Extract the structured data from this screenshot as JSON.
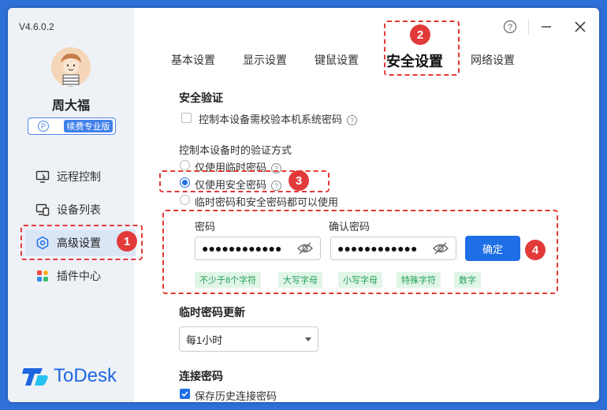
{
  "app": {
    "version": "V4.6.0.2",
    "brand": "ToDesk"
  },
  "user": {
    "name": "周大福",
    "badge_icon": "P",
    "badge_label": "续费专业版"
  },
  "sidebar": {
    "items": [
      {
        "label": "远程控制",
        "icon": "remote-control-icon"
      },
      {
        "label": "设备列表",
        "icon": "devices-icon"
      },
      {
        "label": "高级设置",
        "icon": "settings-hex-icon",
        "active": true
      },
      {
        "label": "插件中心",
        "icon": "plugins-icon"
      }
    ]
  },
  "window_controls": {
    "help": "?",
    "minimize": "—",
    "close": "✕"
  },
  "tabs": [
    {
      "label": "基本设置"
    },
    {
      "label": "显示设置"
    },
    {
      "label": "键鼠设置"
    },
    {
      "label": "安全设置",
      "active": true
    },
    {
      "label": "网络设置"
    }
  ],
  "markers": {
    "m1": "1",
    "m2": "2",
    "m3": "3",
    "m4": "4"
  },
  "security": {
    "title": "安全验证",
    "check_local_pw": {
      "label": "控制本设备需校验本机系统密码",
      "checked": false
    },
    "verify_method_title": "控制本设备时的验证方式",
    "options": [
      {
        "label": "仅使用临时密码",
        "selected": false,
        "help": true
      },
      {
        "label": "仅使用安全密码",
        "selected": true,
        "help": true
      },
      {
        "label": "临时密码和安全密码都可以使用",
        "selected": false,
        "help": false
      }
    ],
    "password_label": "密码",
    "confirm_label": "确认密码",
    "password_value": "●●●●●●●●●●●●",
    "confirm_value": "●●●●●●●●●●●●",
    "confirm_button": "确定",
    "rules": [
      "不少于8个字符",
      "大写字母",
      "小写字母",
      "特殊字符",
      "数字"
    ]
  },
  "temp_pw": {
    "title": "临时密码更新",
    "selected": "每1小时"
  },
  "connect_pw": {
    "title": "连接密码",
    "save_history": "保存历史连接密码",
    "checked": true
  },
  "colors": {
    "accent": "#1e6fe6",
    "marker_red": "#e23a3a",
    "tag_green": "#23a05a",
    "background": "#2f6fd8"
  }
}
